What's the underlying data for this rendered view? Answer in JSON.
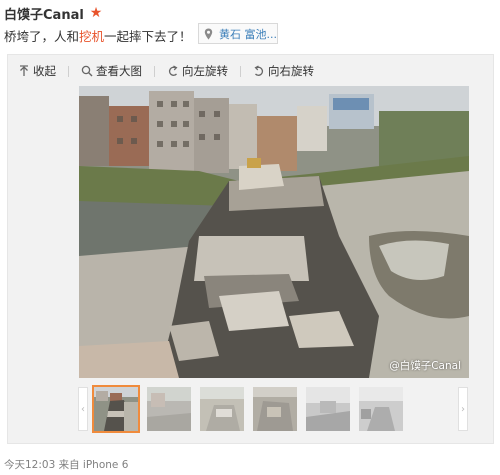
{
  "post": {
    "author": "白馍子Canal",
    "text_before": "桥垮了，人和",
    "text_link": "挖机",
    "text_after": "一起摔下去了！",
    "location_label": "黄石 富池..."
  },
  "toolbar": {
    "collapse_label": "收起",
    "view_large_label": "查看大图",
    "rotate_left_label": "向左旋转",
    "rotate_right_label": "向右旋转"
  },
  "image": {
    "watermark": "@白馍子Canal"
  },
  "thumbnails": {
    "count": 6,
    "active_index": 0
  },
  "footer": {
    "time_source": "今天12:03 来自 iPhone 6"
  },
  "icons": {
    "star": "star-icon",
    "location": "location-pin-icon",
    "collapse": "collapse-arrow-icon",
    "zoom": "magnifier-icon",
    "rotate_left": "rotate-left-icon",
    "rotate_right": "rotate-right-icon"
  },
  "colors": {
    "star": "#e8542c",
    "link": "#e8542c",
    "location_text": "#3c7fb9",
    "active_thumb_border": "#f08b3c"
  }
}
